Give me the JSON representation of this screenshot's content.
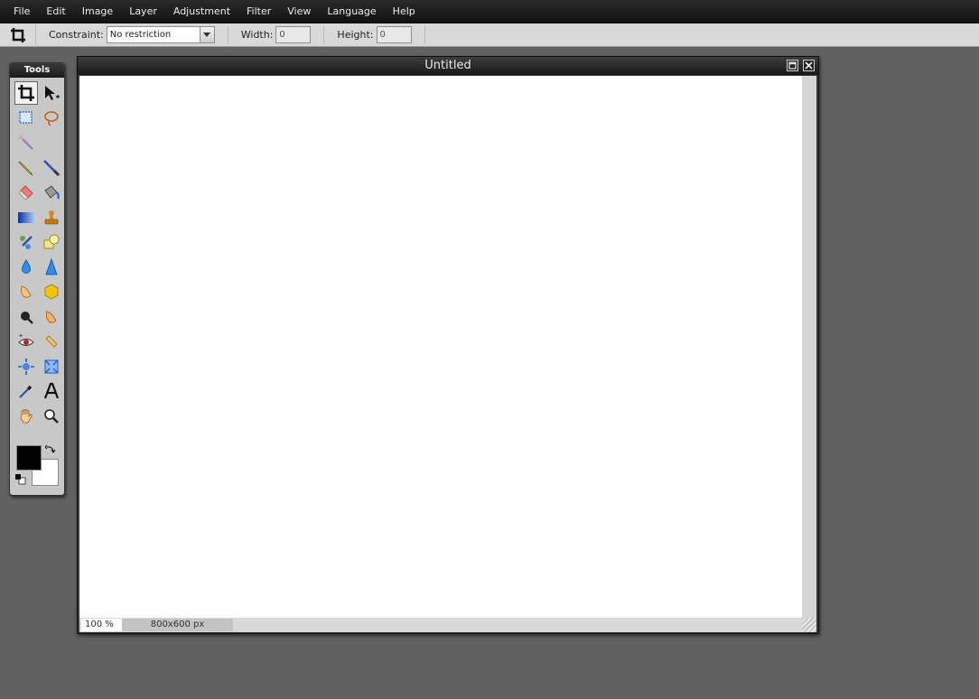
{
  "menubar": {
    "items": [
      "File",
      "Edit",
      "Image",
      "Layer",
      "Adjustment",
      "Filter",
      "View",
      "Language",
      "Help"
    ]
  },
  "options": {
    "constraint_label": "Constraint:",
    "constraint_value": "No restriction",
    "width_label": "Width:",
    "width_value": "0",
    "height_label": "Height:",
    "height_value": "0"
  },
  "tools": {
    "title": "Tools",
    "items": [
      {
        "name": "crop-icon",
        "active": true
      },
      {
        "name": "move-icon"
      },
      {
        "name": "marquee-icon"
      },
      {
        "name": "lasso-icon"
      },
      {
        "name": "magic-wand-icon"
      },
      {
        "name": "empty"
      },
      {
        "name": "pencil-icon"
      },
      {
        "name": "brush-icon"
      },
      {
        "name": "eraser-icon"
      },
      {
        "name": "paint-bucket-icon"
      },
      {
        "name": "gradient-icon"
      },
      {
        "name": "clone-stamp-icon"
      },
      {
        "name": "color-replace-icon"
      },
      {
        "name": "shape-icon"
      },
      {
        "name": "blur-icon"
      },
      {
        "name": "sharpen-icon"
      },
      {
        "name": "smudge-icon"
      },
      {
        "name": "sponge-icon"
      },
      {
        "name": "dodge-icon"
      },
      {
        "name": "burn-icon"
      },
      {
        "name": "red-eye-icon"
      },
      {
        "name": "spot-heal-icon"
      },
      {
        "name": "bloat-icon"
      },
      {
        "name": "pinch-icon"
      },
      {
        "name": "color-picker-icon"
      },
      {
        "name": "type-icon"
      },
      {
        "name": "hand-icon"
      },
      {
        "name": "zoom-icon"
      }
    ],
    "foreground_color": "#000000",
    "background_color": "#ffffff"
  },
  "document": {
    "title": "Untitled",
    "zoom": "100 %",
    "size": "800x600 px"
  }
}
